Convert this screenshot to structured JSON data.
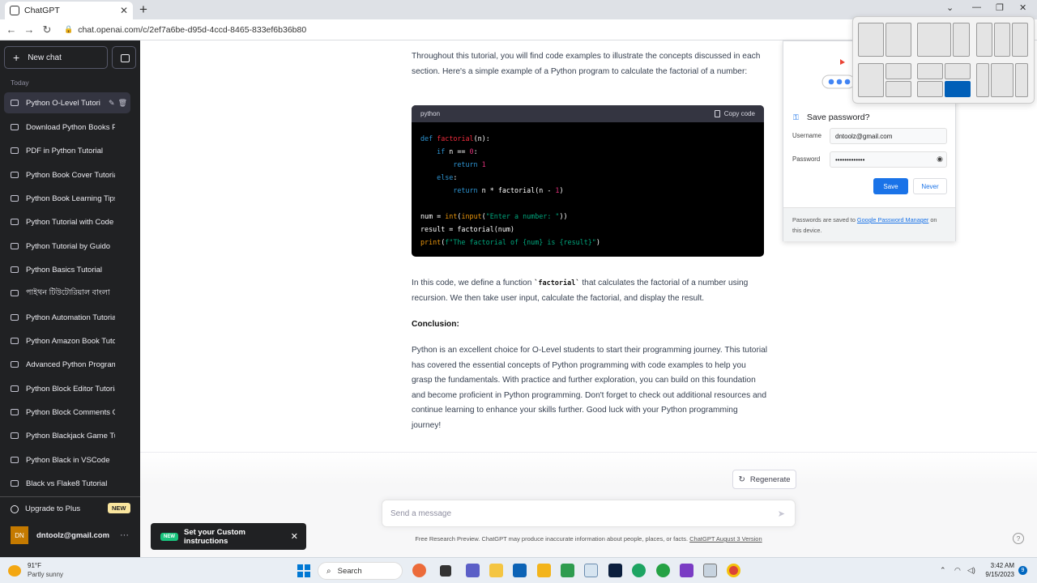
{
  "browser": {
    "tab_title": "ChatGPT",
    "url": "chat.openai.com/c/2ef7a6be-d95d-4ccd-8465-833ef6b36b80"
  },
  "sidebar": {
    "new_chat": "New chat",
    "section_label": "Today",
    "conversations": [
      "Python O-Level Tutori",
      "Download Python Books PDF",
      "PDF in Python Tutorial",
      "Python Book Cover Tutorial",
      "Python Book Learning Tips",
      "Python Tutorial with Code",
      "Python Tutorial by Guido",
      "Python Basics Tutorial",
      "পাইথন টিউটোরিয়াল বাংলা",
      "Python Automation Tutorial",
      "Python Amazon Book Tutorial",
      "Advanced Python Programming",
      "Python Block Editor Tutorial",
      "Python Block Comments Guide",
      "Python Blackjack Game Tutorial",
      "Python Black in VSCode",
      "Black vs Flake8 Tutorial"
    ],
    "upgrade_label": "Upgrade to Plus",
    "upgrade_badge": "NEW",
    "user_initials": "DN",
    "user_email": "dntoolz@gmail.com"
  },
  "content": {
    "intro_paragraph": "Throughout this tutorial, you will find code examples to illustrate the concepts discussed in each section. Here's a simple example of a Python program to calculate the factorial of a number:",
    "code_language": "python",
    "copy_code_label": "Copy code",
    "explain_pre": "In this code, we define a function ",
    "explain_code": "`factorial`",
    "explain_post": " that calculates the factorial of a number using recursion. We then take user input, calculate the factorial, and display the result.",
    "conclusion_heading": "Conclusion:",
    "conclusion_paragraph": "Python is an excellent choice for O-Level students to start their programming journey. This tutorial has covered the essential concepts of Python programming with code examples to help you grasp the fundamentals. With practice and further exploration, you can build on this foundation and become proficient in Python programming. Don't forget to check out additional resources and continue learning to enhance your skills further. Good luck with your Python programming journey!"
  },
  "composer": {
    "regenerate_label": "Regenerate",
    "placeholder": "Send a message",
    "disclaimer": "Free Research Preview. ChatGPT may produce inaccurate information about people, places, or facts.",
    "version_link": "ChatGPT August 3 Version"
  },
  "toast": {
    "badge": "NEW",
    "text": "Set your Custom instructions"
  },
  "password_popup": {
    "title": "Save password?",
    "username_label": "Username",
    "username_value": "dntoolz@gmail.com",
    "password_label": "Password",
    "password_value": "•••••••••••••",
    "save_label": "Save",
    "never_label": "Never",
    "footer_pre": "Passwords are saved to ",
    "footer_link": "Google Password Manager",
    "footer_post": " on this device."
  },
  "taskbar": {
    "temperature": "91°F",
    "weather": "Partly sunny",
    "search_label": "Search",
    "time": "3:42 AM",
    "date": "9/15/2023",
    "notification_count": "9"
  },
  "colors": {
    "sidebar_bg": "#202123",
    "accent_blue": "#1a73e8",
    "new_badge": "#19c37d"
  }
}
